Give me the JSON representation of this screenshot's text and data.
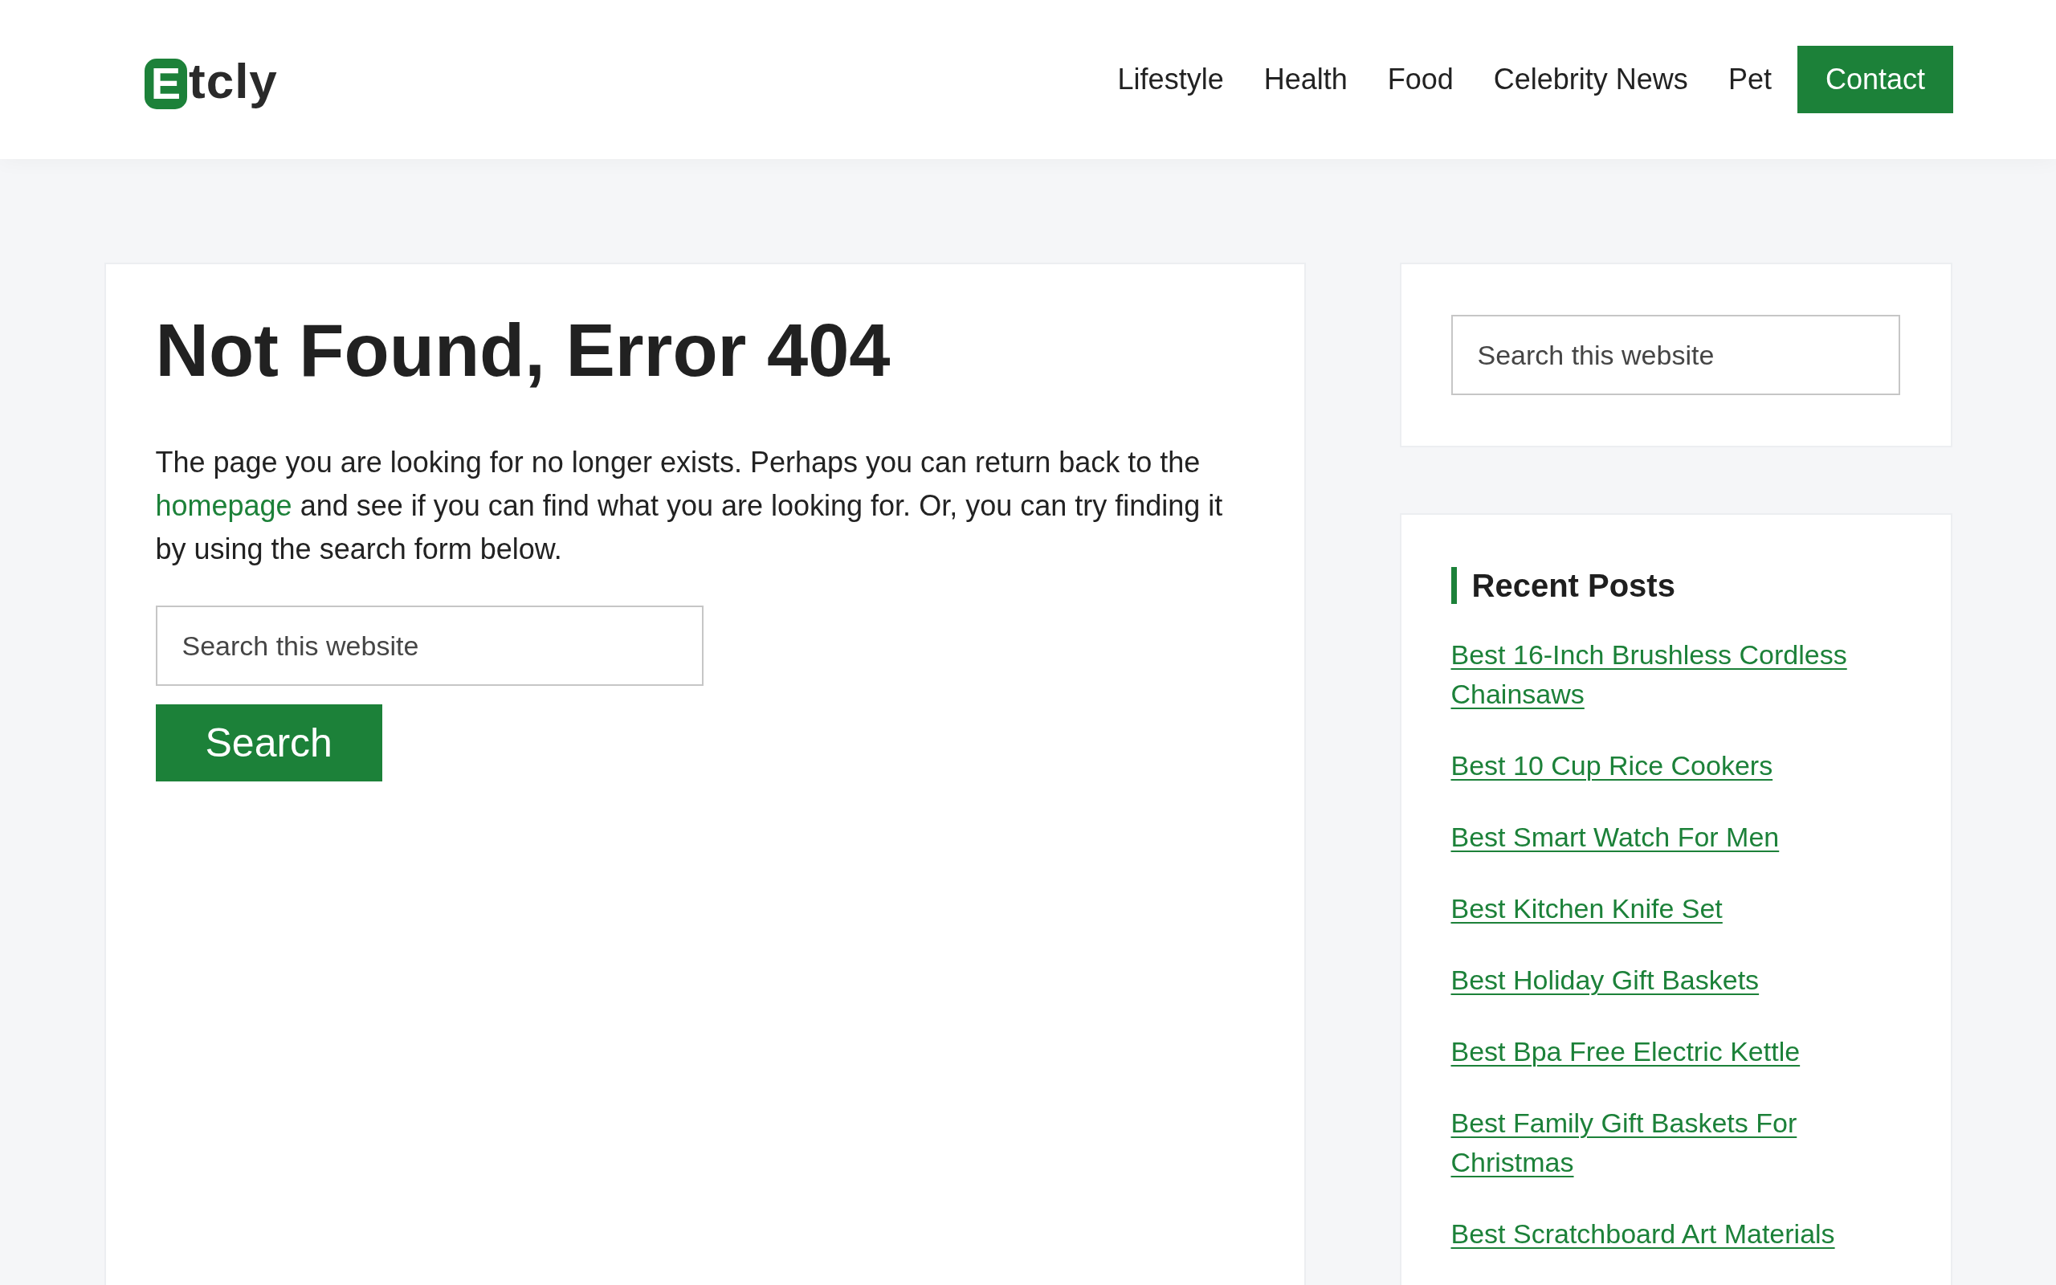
{
  "header": {
    "logo": {
      "initial": "E",
      "rest": "tcly"
    },
    "nav": [
      {
        "label": "Lifestyle",
        "kind": "link"
      },
      {
        "label": "Health",
        "kind": "link"
      },
      {
        "label": "Food",
        "kind": "link"
      },
      {
        "label": "Celebrity News",
        "kind": "link"
      },
      {
        "label": "Pet",
        "kind": "link"
      },
      {
        "label": "Contact",
        "kind": "button"
      }
    ]
  },
  "content": {
    "title": "Not Found, Error 404",
    "message": {
      "before": "The page you are looking for no longer exists. Perhaps you can return back to the ",
      "link": "homepage",
      "after": " and see if you can find what you are looking for. Or, you can try finding it by using the search form below."
    },
    "search": {
      "placeholder": "Search this website",
      "button": "Search"
    }
  },
  "sidebar": {
    "search": {
      "placeholder": "Search this website"
    },
    "recent_posts": {
      "title": "Recent Posts",
      "posts": [
        "Best 16-Inch Brushless Cordless Chainsaws",
        "Best 10 Cup Rice Cookers",
        "Best Smart Watch For Men",
        "Best Kitchen Knife Set",
        "Best Holiday Gift Baskets",
        "Best Bpa Free Electric Kettle",
        "Best Family Gift Baskets For Christmas",
        "Best Scratchboard Art Materials"
      ]
    }
  }
}
